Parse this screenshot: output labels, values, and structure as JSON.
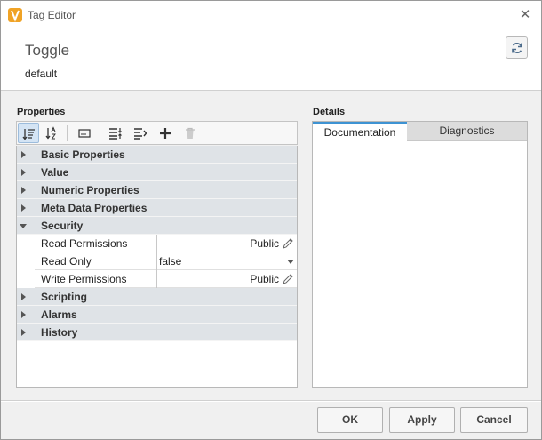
{
  "window": {
    "title": "Tag Editor",
    "close_glyph": "✕",
    "app_icon": "ignition-logo-icon"
  },
  "header": {
    "tag_name": "Toggle",
    "tag_provider": "default",
    "refresh_icon": "refresh-icon"
  },
  "properties": {
    "label": "Properties",
    "toolbar": [
      {
        "icon": "sort-categorized-icon",
        "active": true
      },
      {
        "icon": "sort-alphabetical-icon",
        "active": false
      },
      {
        "icon": "description-icon",
        "active": false
      },
      {
        "icon": "expand-all-icon",
        "active": false
      },
      {
        "icon": "collapse-all-icon",
        "active": false
      },
      {
        "icon": "add-icon",
        "active": false
      },
      {
        "icon": "delete-icon",
        "active": false
      }
    ],
    "rows": {
      "basic": "Basic Properties",
      "value": "Value",
      "numeric": "Numeric Properties",
      "meta": "Meta Data Properties",
      "security": "Security",
      "read_permissions": {
        "name": "Read Permissions",
        "value": "Public"
      },
      "read_only": {
        "name": "Read Only",
        "value": "false"
      },
      "write_permissions": {
        "name": "Write Permissions",
        "value": "Public"
      },
      "scripting": "Scripting",
      "alarms": "Alarms",
      "history": "History"
    }
  },
  "details": {
    "label": "Details",
    "tabs": [
      "Documentation",
      "Diagnostics"
    ],
    "active_tab": "Documentation",
    "accent_color": "#3e93d3"
  },
  "footer": {
    "ok": "OK",
    "apply": "Apply",
    "cancel": "Cancel"
  }
}
